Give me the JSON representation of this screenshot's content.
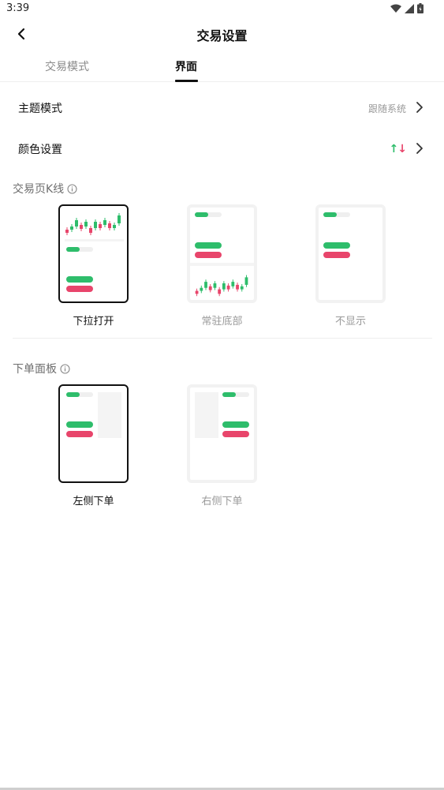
{
  "status_bar": {
    "time": "3:39"
  },
  "nav": {
    "title": "交易设置"
  },
  "tabs": [
    {
      "label": "交易模式",
      "active": false
    },
    {
      "label": "界面",
      "active": true
    }
  ],
  "settings": {
    "theme": {
      "label": "主题模式",
      "value": "跟随系统"
    },
    "color": {
      "label": "颜色设置",
      "up_symbol": "↑",
      "down_symbol": "↓"
    }
  },
  "kline_section": {
    "title": "交易页K线",
    "options": [
      {
        "label": "下拉打开",
        "selected": true
      },
      {
        "label": "常驻底部",
        "selected": false
      },
      {
        "label": "不显示",
        "selected": false
      }
    ]
  },
  "order_section": {
    "title": "下单面板",
    "options": [
      {
        "label": "左侧下单",
        "selected": true
      },
      {
        "label": "右侧下单",
        "selected": false
      }
    ]
  },
  "colors": {
    "up": "#2ebd6b",
    "down": "#e8456b",
    "accent": "#111111"
  },
  "icons": [
    "back-arrow-icon",
    "chevron-right-icon",
    "info-icon",
    "wifi-icon",
    "signal-icon",
    "battery-icon"
  ]
}
